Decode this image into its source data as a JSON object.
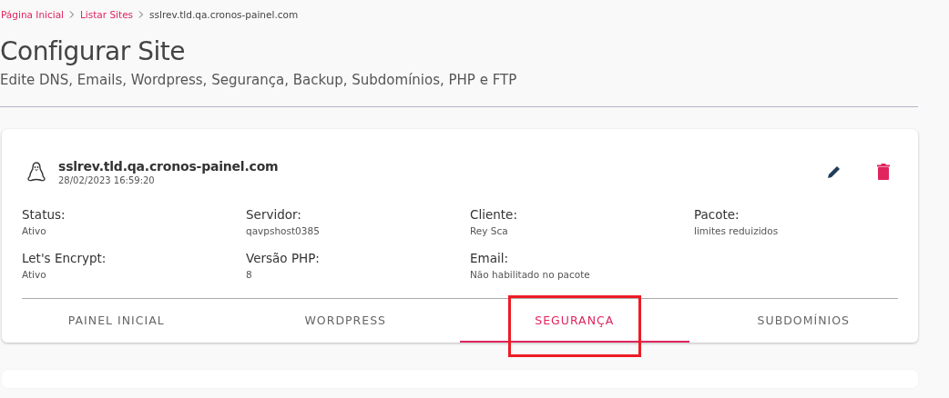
{
  "breadcrumb": [
    {
      "label": "Página Inicial",
      "link": true
    },
    {
      "label": "Listar Sites",
      "link": true
    },
    {
      "label": "sslrev.tld.qa.cronos-painel.com",
      "link": false
    }
  ],
  "title": "Configurar Site",
  "subtitle": "Edite DNS, Emails, Wordpress, Segurança, Backup, Subdomínios, PHP e FTP",
  "site": {
    "domain": "sslrev.tld.qa.cronos-painel.com",
    "date": "28/02/2023 16:59:20"
  },
  "fields": [
    {
      "label": "Status:",
      "value": "Ativo"
    },
    {
      "label": "Servidor:",
      "value": "qavpshost0385"
    },
    {
      "label": "Cliente:",
      "value": "Rey Sca"
    },
    {
      "label": "Pacote:",
      "value": "limites reduizidos"
    },
    {
      "label": "Let's Encrypt:",
      "value": "Ativo"
    },
    {
      "label": "Versão PHP:",
      "value": "8"
    },
    {
      "label": "Email:",
      "value": "Não habilitado no pacote"
    }
  ],
  "tabs": [
    {
      "label": "PAINEL INICIAL",
      "selected": false,
      "highlighted": false
    },
    {
      "label": "WORDPRESS",
      "selected": false,
      "highlighted": false
    },
    {
      "label": "SEGURANÇA",
      "selected": true,
      "highlighted": true
    },
    {
      "label": "SUBDOMÍNIOS",
      "selected": false,
      "highlighted": false
    }
  ]
}
